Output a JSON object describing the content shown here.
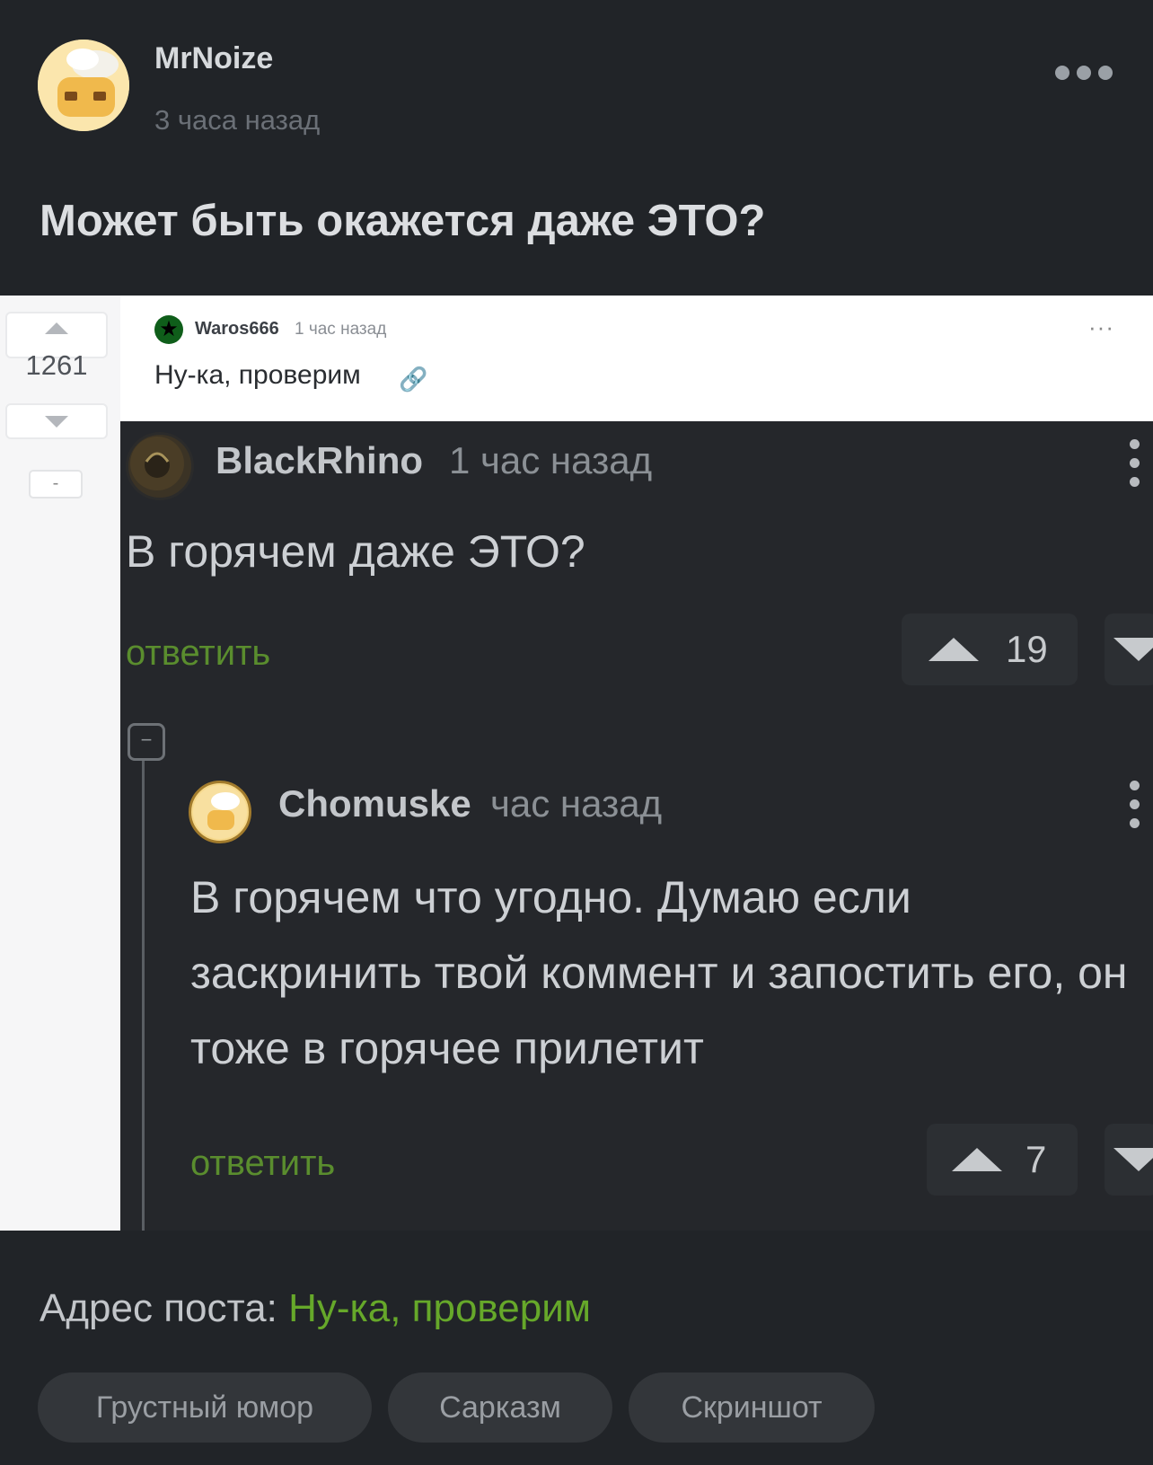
{
  "post": {
    "author": "MrNoize",
    "time": "3 часа назад",
    "title": "Может быть окажется даже ЭТО?"
  },
  "screenshot": {
    "rating": "1261",
    "collapse": "-",
    "comment": {
      "author": "Waros666",
      "time": "1 час назад",
      "text": "Ну-ка, проверим",
      "dots": "···"
    },
    "nested": [
      {
        "author": "BlackRhino",
        "time": "1 час назад",
        "text": "В горячем даже ЭТО?",
        "reply": "ответить",
        "votes": "19"
      },
      {
        "author": "Chomuske",
        "time": "час назад",
        "text": "В горячем что угодно. Думаю если заскринить твой коммент и запостить его, он тоже в горячее прилетит",
        "reply": "ответить",
        "votes": "7"
      }
    ]
  },
  "footer": {
    "address_label": "Адрес поста:",
    "address_link": "Ну-ка, проверим",
    "tags": [
      "Грустный юмор",
      "Сарказм",
      "Скриншот"
    ]
  },
  "colors": {
    "background": "#212428",
    "accent_green": "#66a82a",
    "tag_bg": "#33363a"
  }
}
